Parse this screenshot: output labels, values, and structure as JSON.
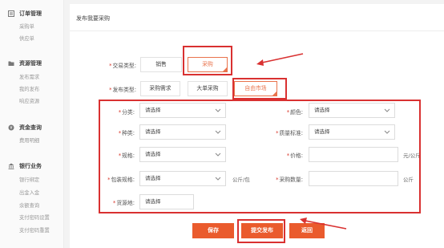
{
  "sidebar": {
    "sections": [
      {
        "title": "订单管理",
        "icon": "list-icon",
        "items": [
          "采购单",
          "供应单"
        ]
      },
      {
        "title": "资源管理",
        "icon": "folder-icon",
        "items": [
          "发布需求",
          "我的发布",
          "响应资源"
        ]
      },
      {
        "title": "资金查询",
        "icon": "money-icon",
        "items": [
          "费用明细"
        ]
      },
      {
        "title": "银行业务",
        "icon": "bank-icon",
        "items": [
          "银行绑定",
          "出金入金",
          "余额查询",
          "支付密码设置",
          "支付密码重置"
        ]
      }
    ]
  },
  "page": {
    "title": "发布我要采购"
  },
  "form": {
    "trade_type": {
      "label": "交易类型:",
      "options": [
        "销售",
        "采购"
      ],
      "selected": "采购"
    },
    "publish_type": {
      "label": "发布类型:",
      "options": [
        "采购需求",
        "大单采购",
        "自由市场"
      ],
      "selected": "自由市场"
    },
    "category": {
      "label": "分类:",
      "value": "请选择"
    },
    "color": {
      "label": "颜色:",
      "value": "请选择"
    },
    "variety": {
      "label": "种类:",
      "value": "请选择"
    },
    "quality": {
      "label": "质量标准:",
      "value": "请选择"
    },
    "spec": {
      "label": "规格:",
      "value": "请选择"
    },
    "price": {
      "label": "价格:",
      "value": "",
      "unit": "元/公斤"
    },
    "package_spec": {
      "label": "包装规格:",
      "value": "请选择",
      "unit": "公斤/包"
    },
    "quantity": {
      "label": "采购数量:",
      "value": "",
      "unit": "公斤"
    },
    "origin": {
      "label": "货源地:",
      "value": "请选择"
    }
  },
  "buttons": {
    "save": "保存",
    "submit": "提交发布",
    "back": "返回"
  },
  "colors": {
    "accent": "#ea5b2d",
    "annotation": "#d93131"
  }
}
